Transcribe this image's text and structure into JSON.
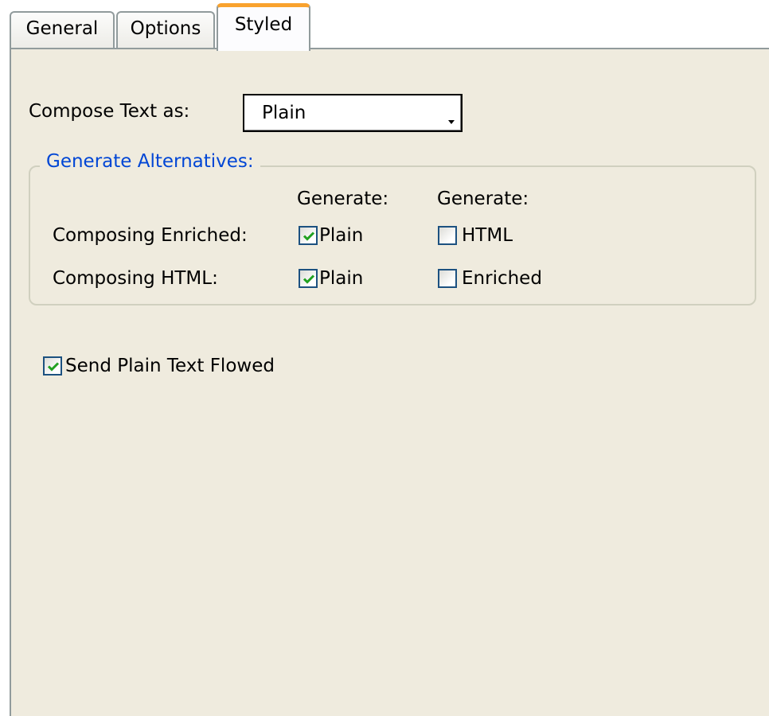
{
  "tabs": [
    {
      "label": "General",
      "selected": false
    },
    {
      "label": "Options",
      "selected": false
    },
    {
      "label": "Styled",
      "selected": true
    }
  ],
  "compose": {
    "label": "Compose Text as:",
    "value": "Plain"
  },
  "alternatives": {
    "legend": "Generate Alternatives:",
    "col1_header": "Generate:",
    "col2_header": "Generate:",
    "rows": [
      {
        "label": "Composing Enriched:",
        "opt1": {
          "label": "Plain",
          "checked": true
        },
        "opt2": {
          "label": "HTML",
          "checked": false
        }
      },
      {
        "label": "Composing HTML:",
        "opt1": {
          "label": "Plain",
          "checked": true
        },
        "opt2": {
          "label": "Enriched",
          "checked": false
        }
      }
    ]
  },
  "flowed": {
    "label": "Send Plain Text Flowed",
    "checked": true
  },
  "colors": {
    "panel": "#efebde",
    "tab_highlight": "#f9a22e",
    "group_legend": "#0046d5",
    "checkmark": "#21a121",
    "checkbox_border": "#1c5180"
  },
  "icons": {
    "dropdown": "chevron-down-icon",
    "check": "checkmark-icon"
  }
}
